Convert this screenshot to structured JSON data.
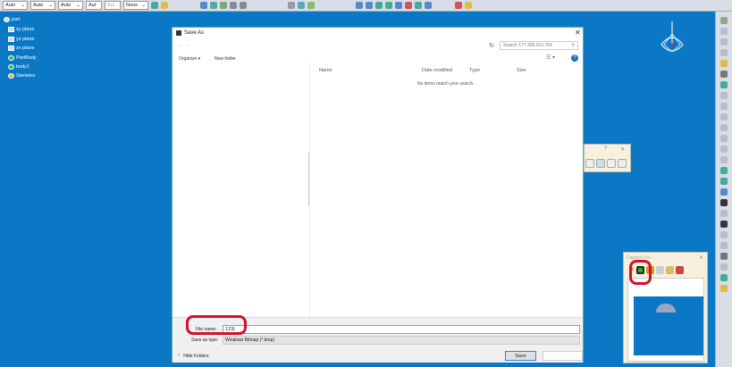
{
  "toolbar": {
    "selects": [
      "Auto",
      "Auto",
      "Auto",
      "Aut",
      "Aut",
      "None"
    ]
  },
  "tree": [
    "part",
    "xy plane",
    "yz plane",
    "zx plane",
    "PartBody",
    "body1",
    "Skeleton"
  ],
  "dialog": {
    "title": "Save As",
    "search_placeholder": "Search 177.300.012.754",
    "organize": "Organize ▾",
    "new_folder": "New folder",
    "columns": [
      "Name",
      "Date modified",
      "Type",
      "Size"
    ],
    "empty_message": "No items match your search.",
    "file_name_label": "File name:",
    "file_name_value": "123",
    "save_type_label": "Save as type:",
    "save_type_value": "Windows Bitmap (*.bmp)",
    "hide_folders": "Hide Folders",
    "save_label": "Save",
    "close": "✕",
    "help": "?"
  },
  "small_dialog": {
    "help": "?",
    "close": "✕"
  },
  "capture": {
    "title": "Capture Pre...",
    "close": "✕"
  },
  "colors": {
    "background": "#0b78c5",
    "highlight": "#d3102a"
  }
}
